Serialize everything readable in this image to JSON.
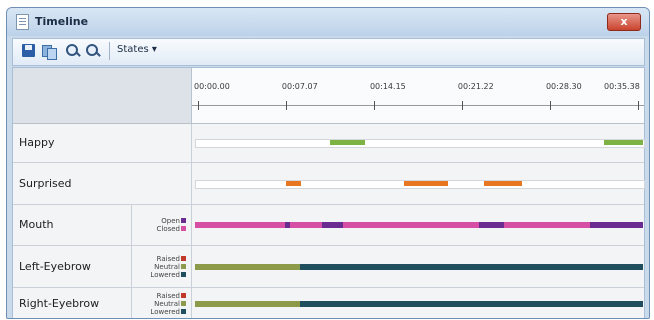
{
  "window": {
    "title": "Timeline",
    "close_label": "x"
  },
  "toolbar": {
    "states_label": "States ▾"
  },
  "ruler": {
    "ticks": [
      {
        "label": "00:00.00",
        "t": 0
      },
      {
        "label": "00:07.07",
        "t": 7.07
      },
      {
        "label": "00:14.15",
        "t": 14.15
      },
      {
        "label": "00:21.22",
        "t": 21.22
      },
      {
        "label": "00:28.30",
        "t": 28.3
      },
      {
        "label": "00:35.38",
        "t": 35.38
      }
    ],
    "span_seconds": 35.38
  },
  "colors": {
    "happy": "#7cb342",
    "surprised": "#e87722",
    "open": "#6a2c91",
    "closed": "#d64fa5",
    "raised": "#c0392b",
    "neutral": "#8c9a4a",
    "lowered": "#1f4e5f"
  },
  "rows": [
    {
      "name": "Happy",
      "type": "event",
      "segments": [
        {
          "start": 10.7,
          "end": 13.4
        },
        {
          "start": 32.3,
          "end": 35.38
        }
      ]
    },
    {
      "name": "Surprised",
      "type": "event",
      "segments": [
        {
          "start": 7.2,
          "end": 8.4
        },
        {
          "start": 16.5,
          "end": 20.0
        },
        {
          "start": 22.8,
          "end": 25.8
        }
      ]
    },
    {
      "name": "Mouth",
      "type": "state",
      "states": [
        {
          "label": "Open",
          "color_key": "open"
        },
        {
          "label": "Closed",
          "color_key": "closed"
        }
      ],
      "segments": [
        {
          "start": 0,
          "end": 7.1,
          "state": "closed"
        },
        {
          "start": 7.1,
          "end": 7.5,
          "state": "open"
        },
        {
          "start": 7.5,
          "end": 10.0,
          "state": "closed"
        },
        {
          "start": 10.0,
          "end": 11.7,
          "state": "open"
        },
        {
          "start": 11.7,
          "end": 22.4,
          "state": "closed"
        },
        {
          "start": 22.4,
          "end": 24.4,
          "state": "open"
        },
        {
          "start": 24.4,
          "end": 31.2,
          "state": "closed"
        },
        {
          "start": 31.2,
          "end": 35.38,
          "state": "open"
        }
      ]
    },
    {
      "name": "Left-Eyebrow",
      "type": "state",
      "states": [
        {
          "label": "Raised",
          "color_key": "raised"
        },
        {
          "label": "Neutral",
          "color_key": "neutral"
        },
        {
          "label": "Lowered",
          "color_key": "lowered"
        }
      ],
      "segments": [
        {
          "start": 0,
          "end": 8.3,
          "state": "neutral"
        },
        {
          "start": 8.3,
          "end": 35.38,
          "state": "lowered"
        }
      ]
    },
    {
      "name": "Right-Eyebrow",
      "type": "state",
      "states": [
        {
          "label": "Raised",
          "color_key": "raised"
        },
        {
          "label": "Neutral",
          "color_key": "neutral"
        },
        {
          "label": "Lowered",
          "color_key": "lowered"
        }
      ],
      "segments": [
        {
          "start": 0,
          "end": 8.3,
          "state": "neutral"
        },
        {
          "start": 8.3,
          "end": 35.38,
          "state": "lowered"
        }
      ]
    }
  ]
}
